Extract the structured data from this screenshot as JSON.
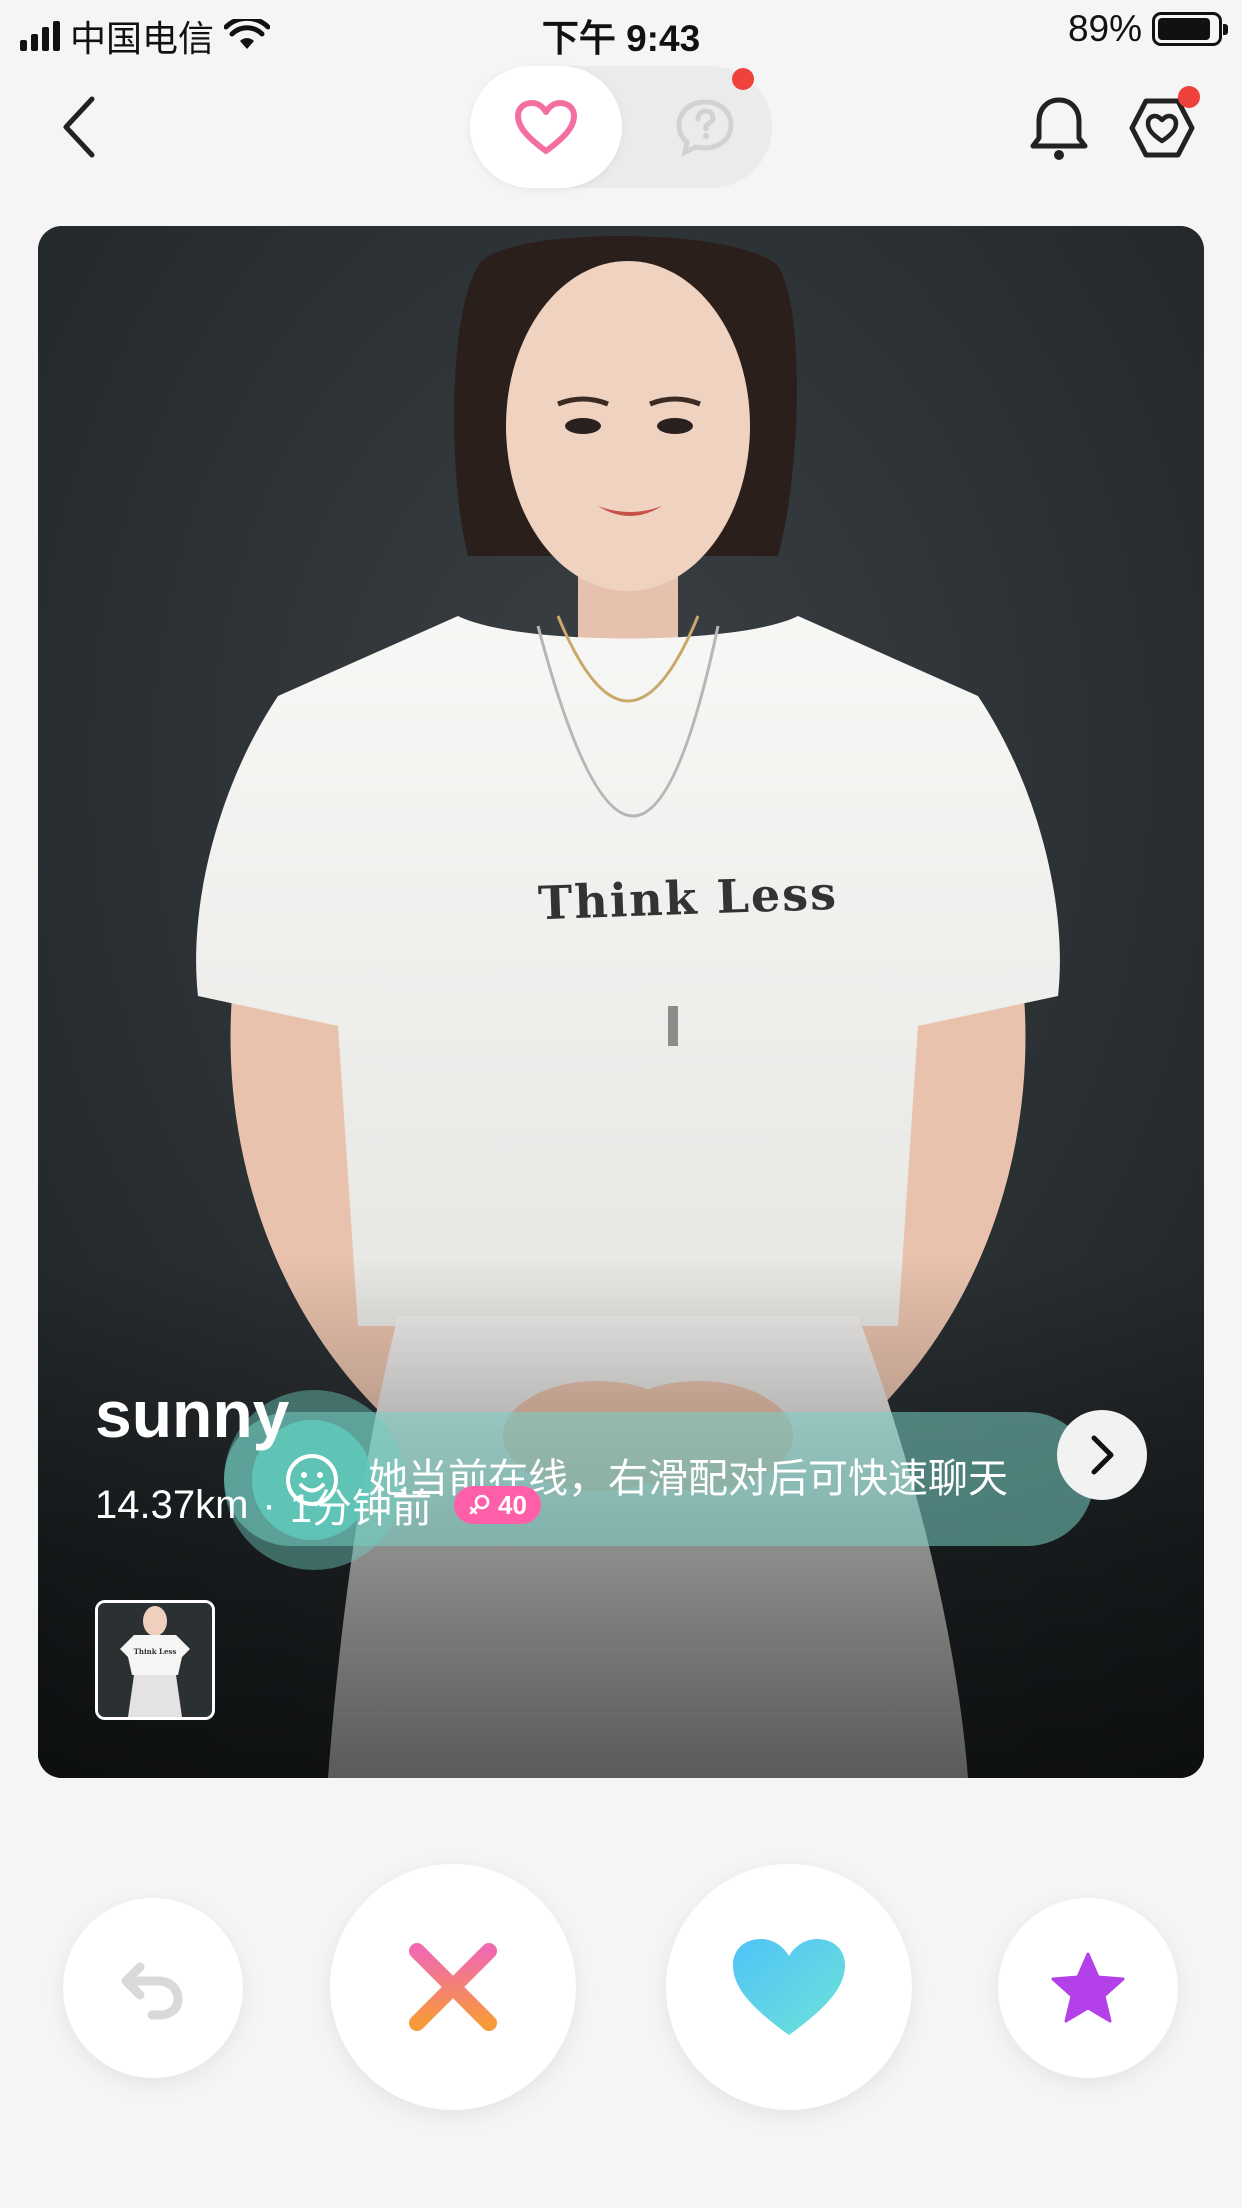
{
  "status_bar": {
    "carrier": "中国电信",
    "time": "下午 9:43",
    "battery_percent": "89%",
    "battery_level": 0.89
  },
  "nav": {
    "back_icon": "chevron-left-icon",
    "tabs": [
      {
        "icon": "heart-icon",
        "active": true,
        "color": "#f46fa1"
      },
      {
        "icon": "question-bubble-icon",
        "active": false,
        "has_badge": true
      }
    ],
    "bell_icon": "bell-icon",
    "hex_heart_icon": "hexagon-heart-icon",
    "hex_heart_badge": true,
    "badge_color": "#f0423c"
  },
  "card": {
    "shirt_text": "Think Less",
    "online_tip": "她当前在线，右滑配对后可快速聊天",
    "name": "sunny",
    "distance": "14.37km",
    "separator": "·",
    "last_active": "1分钟前",
    "badge": {
      "icon": "female-icon",
      "value": "40",
      "color": "#ff5fa8"
    },
    "more_icon": "chevron-right-icon",
    "thumbnail_shirt_text": "Think Less"
  },
  "actions": {
    "undo_icon": "undo-icon",
    "nope_icon": "close-icon",
    "like_icon": "heart-icon",
    "superlike_icon": "star-icon",
    "nope_gradient": [
      "#f06ab0",
      "#f79a3a"
    ],
    "like_gradient": [
      "#4fc3f7",
      "#6fe3d8"
    ],
    "superlike_color": "#b340e8"
  }
}
